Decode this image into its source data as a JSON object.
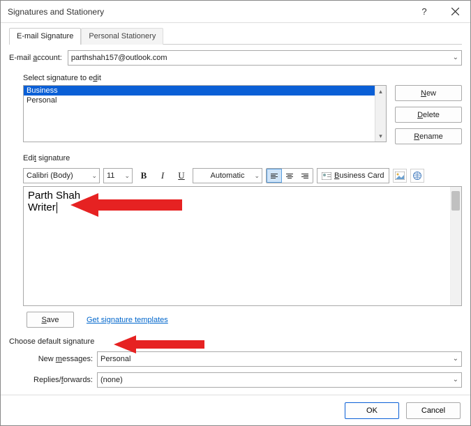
{
  "title": "Signatures and Stationery",
  "tabs": {
    "email": "E-mail Signature",
    "stationery": "Personal Stationery"
  },
  "account": {
    "label_pre": "E-mail ",
    "label_u": "a",
    "label_post": "ccount:",
    "value": "parthshah157@outlook.com"
  },
  "select_label": {
    "pre": "Select signature to e",
    "u": "d",
    "post": "it"
  },
  "signatures": {
    "items": [
      "Business",
      "Personal"
    ],
    "selected_index": 0
  },
  "side_buttons": {
    "new": {
      "u": "N",
      "rest": "ew"
    },
    "delete": {
      "u": "D",
      "rest": "elete"
    },
    "rename": {
      "u": "R",
      "rest": "ename"
    }
  },
  "edit_label": {
    "pre": "Edi",
    "u": "t",
    "post": " signature"
  },
  "toolbar": {
    "font": "Calibri (Body)",
    "size": "11",
    "color": "Automatic",
    "biz_card": {
      "u": "B",
      "rest": "usiness Card"
    }
  },
  "editor": {
    "line1": "Parth Shah",
    "line2": "Writer"
  },
  "save": {
    "u": "S",
    "rest": "ave"
  },
  "templates_link": "Get signature templates",
  "choose_default": "Choose default signature",
  "new_messages": {
    "label_pre": "New ",
    "label_u": "m",
    "label_post": "essages:",
    "value": "Personal"
  },
  "replies": {
    "label_pre": "Replies/",
    "label_u": "f",
    "label_post": "orwards:",
    "value": "(none)"
  },
  "footer": {
    "ok": "OK",
    "cancel": "Cancel"
  }
}
